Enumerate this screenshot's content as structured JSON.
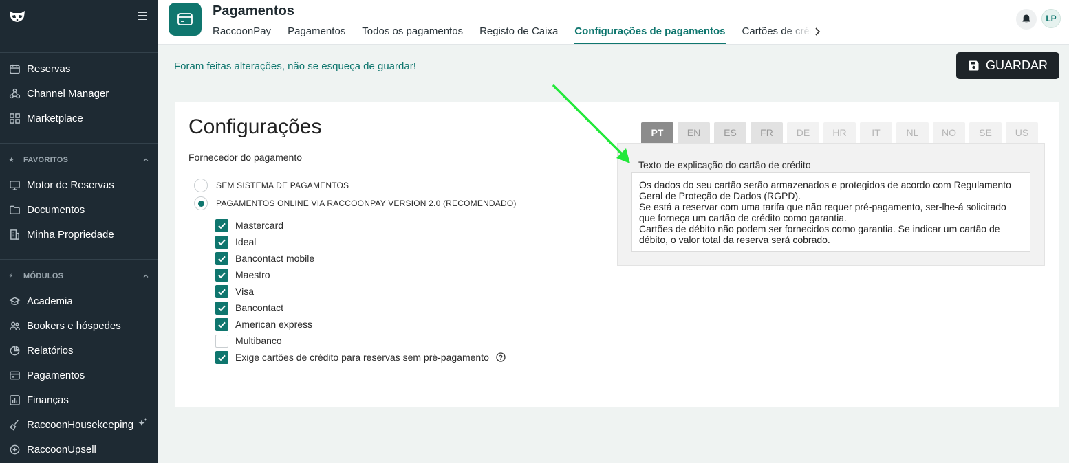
{
  "sidebar": {
    "top_items": [
      {
        "label": "Reservas",
        "icon": "calendar-icon"
      },
      {
        "label": "Channel Manager",
        "icon": "share-icon"
      },
      {
        "label": "Marketplace",
        "icon": "grid-icon"
      }
    ],
    "favorites": {
      "title": "FAVORITOS",
      "items": [
        {
          "label": "Motor de Reservas",
          "icon": "monitor-icon"
        },
        {
          "label": "Documentos",
          "icon": "folder-icon"
        },
        {
          "label": "Minha Propriedade",
          "icon": "building-icon"
        }
      ]
    },
    "modules": {
      "title": "MÓDULOS",
      "items": [
        {
          "label": "Academia",
          "icon": "graduation-icon"
        },
        {
          "label": "Bookers e hóspedes",
          "icon": "users-icon"
        },
        {
          "label": "Relatórios",
          "icon": "pie-chart-icon"
        },
        {
          "label": "Pagamentos",
          "icon": "card-icon"
        },
        {
          "label": "Finanças",
          "icon": "bar-chart-icon"
        },
        {
          "label": "RaccoonHousekeeping",
          "icon": "broom-icon"
        },
        {
          "label": "RaccoonUpsell",
          "icon": "plus-circle-icon"
        }
      ]
    }
  },
  "header": {
    "title": "Pagamentos",
    "tabs": [
      {
        "label": "RaccoonPay",
        "active": false
      },
      {
        "label": "Pagamentos",
        "active": false
      },
      {
        "label": "Todos os pagamentos",
        "active": false
      },
      {
        "label": "Registo de Caixa",
        "active": false
      },
      {
        "label": "Configurações de pagamentos",
        "active": true
      },
      {
        "label": "Cartões de crédito",
        "active": false
      }
    ],
    "avatar_initials": "LP"
  },
  "main": {
    "unsaved_message": "Foram feitas alterações, não se esqueça de guardar!",
    "save_label": "GUARDAR",
    "card": {
      "title": "Configurações",
      "provider_label": "Fornecedor do pagamento",
      "radios": [
        {
          "label": "SEM SISTEMA DE PAGAMENTOS",
          "selected": false
        },
        {
          "label": "PAGAMENTOS ONLINE VIA RACCOONPAY VERSION 2.0 (RECOMENDADO)",
          "selected": true
        }
      ],
      "checkboxes": [
        {
          "label": "Mastercard",
          "checked": true
        },
        {
          "label": "Ideal",
          "checked": true
        },
        {
          "label": "Bancontact mobile",
          "checked": true
        },
        {
          "label": "Maestro",
          "checked": true
        },
        {
          "label": "Visa",
          "checked": true
        },
        {
          "label": "Bancontact",
          "checked": true
        },
        {
          "label": "American express",
          "checked": true
        },
        {
          "label": "Multibanco",
          "checked": false
        },
        {
          "label": "Exige cartões de crédito para reservas sem pré-pagamento",
          "checked": true
        }
      ],
      "languages": [
        "PT",
        "EN",
        "ES",
        "FR",
        "DE",
        "HR",
        "IT",
        "NL",
        "NO",
        "SE",
        "US"
      ],
      "active_language": "PT",
      "text_label": "Texto de explicação do cartão de crédito",
      "text_value": "Os dados do seu cartão serão armazenados e protegidos de acordo com Regulamento Geral de Proteção de Dados (RGPD).\nSe está a reservar com uma tarifa que não requer pré-pagamento, ser-lhe-á solicitado que forneça um cartão de crédito como garantia.\nCartões de débito não podem ser fornecidos como garantia. Se indicar um cartão de débito, o valor total da reserva será cobrado."
    }
  },
  "colors": {
    "sidebar_bg": "#1e2a33",
    "accent": "#0f766e",
    "annotation_arrow": "#22e83a"
  }
}
